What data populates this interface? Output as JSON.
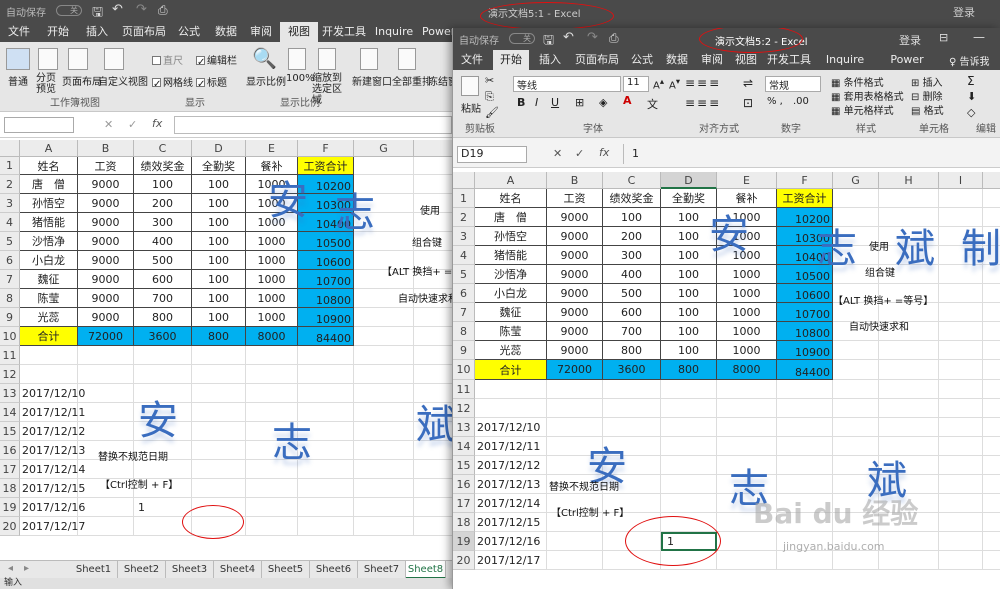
{
  "winA": {
    "title": "演示文档5:1  -  Excel",
    "autosave": "自动保存",
    "autosave_state": "关",
    "login": "登录",
    "tabs": [
      "文件",
      "开始",
      "插入",
      "页面布局",
      "公式",
      "数据",
      "审阅",
      "视图",
      "开发工具",
      "Inquire",
      "Power"
    ],
    "active_tab": "视图",
    "ribbon": {
      "normal": "普通",
      "page_break": "分页预览",
      "page_layout": "页面布局",
      "custom_view": "自定义视图",
      "ruler": "直尺",
      "formula_bar": "编辑栏",
      "gridlines": "网格线",
      "headings": "标题",
      "zoom": "显示比例",
      "zoom100": "100%",
      "zoom_sel": "缩放到选定区域",
      "new_window": "新建窗口",
      "arrange_all": "全部重排",
      "freeze": "冻结窗",
      "grp_views": "工作簿视图",
      "grp_show": "显示",
      "grp_zoom": "显示比例"
    },
    "namebox": "",
    "fx": "fx",
    "cols": [
      "A",
      "B",
      "C",
      "D",
      "E",
      "F",
      "G"
    ],
    "rows": [
      "1",
      "2",
      "3",
      "4",
      "5",
      "6",
      "7",
      "8",
      "9",
      "10",
      "11",
      "12",
      "13",
      "14",
      "15",
      "16",
      "17",
      "18",
      "19",
      "20"
    ],
    "sheets": [
      "Sheet1",
      "Sheet2",
      "Sheet3",
      "Sheet4",
      "Sheet5",
      "Sheet6",
      "Sheet7",
      "Sheet8"
    ],
    "active_sheet": "Sheet8",
    "status": "输入",
    "b19_value": "1"
  },
  "winB": {
    "title": "演示文档5:2  -  Excel",
    "autosave": "自动保存",
    "autosave_state": "关",
    "login": "登录",
    "tabs": [
      "文件",
      "开始",
      "插入",
      "页面布局",
      "公式",
      "数据",
      "审阅",
      "视图",
      "开发工具",
      "Inquire",
      "Power Pivot"
    ],
    "active_tab": "开始",
    "tell_me": "告诉我",
    "ribbon": {
      "paste": "粘贴",
      "font_name": "等线",
      "font_size": "11",
      "number_format": "常规",
      "cond_format": "条件格式",
      "table_format": "套用表格格式",
      "cell_style": "单元格样式",
      "insert": "插入",
      "delete": "删除",
      "format": "格式",
      "grp_clipboard": "剪贴板",
      "grp_font": "字体",
      "grp_align": "对齐方式",
      "grp_number": "数字",
      "grp_style": "样式",
      "grp_cells": "单元格",
      "grp_edit": "编辑"
    },
    "namebox": "D19",
    "formula": "1",
    "fx": "fx",
    "cols": [
      "A",
      "B",
      "C",
      "D",
      "E",
      "F",
      "G",
      "H",
      "I"
    ],
    "rows": [
      "1",
      "2",
      "3",
      "4",
      "5",
      "6",
      "7",
      "8",
      "9",
      "10",
      "11",
      "12",
      "13",
      "14",
      "15",
      "16",
      "17",
      "18",
      "19",
      "20"
    ],
    "b19_value": "1"
  },
  "table": {
    "headers": [
      "姓名",
      "工资",
      "绩效奖金",
      "全勤奖",
      "餐补",
      "工资合计"
    ],
    "rows": [
      [
        "唐　僧",
        "9000",
        "100",
        "100",
        "1000",
        "10200"
      ],
      [
        "孙悟空",
        "9000",
        "200",
        "100",
        "1000",
        "10300"
      ],
      [
        "猪悟能",
        "9000",
        "300",
        "100",
        "1000",
        "10400"
      ],
      [
        "沙悟净",
        "9000",
        "400",
        "100",
        "1000",
        "10500"
      ],
      [
        "小白龙",
        "9000",
        "500",
        "100",
        "1000",
        "10600"
      ],
      [
        "魏征",
        "9000",
        "600",
        "100",
        "1000",
        "10700"
      ],
      [
        "陈莹",
        "9000",
        "700",
        "100",
        "1000",
        "10800"
      ],
      [
        "光蕊",
        "9000",
        "800",
        "100",
        "1000",
        "10900"
      ]
    ],
    "total": [
      "合计",
      "72000",
      "3600",
      "800",
      "8000",
      "84400"
    ]
  },
  "notes": {
    "use": "使用",
    "combo": "组合键",
    "alt": "【ALT 换挡+ =等号】",
    "autosum": "自动快速求和",
    "replace": "替换不规范日期",
    "ctrlf": "【Ctrl控制 + F】"
  },
  "dates": [
    "2017/12/10",
    "2017/12/11",
    "2017/12/12",
    "2017/12/13",
    "2017/12/14",
    "2017/12/15",
    "2017/12/16",
    "2017/12/17"
  ],
  "bigchars": [
    "安",
    "志",
    "斌",
    "制"
  ],
  "watermark": {
    "brand": "Bai du 经验",
    "url": "jingyan.baidu.com"
  },
  "colors": {
    "yellow": "#ffff00",
    "blue": "#00b0f0",
    "excel_green": "#217346",
    "annotation_red": "#e01010"
  }
}
